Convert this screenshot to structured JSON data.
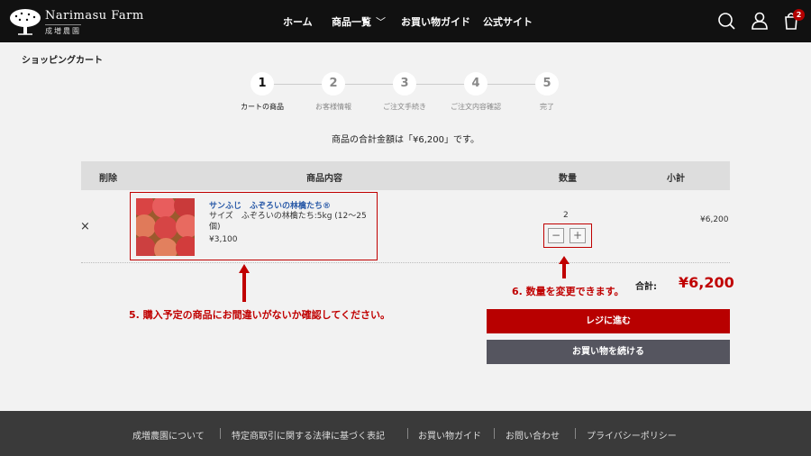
{
  "header": {
    "brand": "Narimasu Farm",
    "brand_sub": "成増農園",
    "nav": [
      "ホーム",
      "商品一覧",
      "お買い物ガイド",
      "公式サイト"
    ],
    "cart_count": "2"
  },
  "page_title": "ショッピングカート",
  "steps": [
    {
      "num": "1",
      "label": "カートの商品"
    },
    {
      "num": "2",
      "label": "お客様情報"
    },
    {
      "num": "3",
      "label": "ご注文手続き"
    },
    {
      "num": "4",
      "label": "ご注文内容確認"
    },
    {
      "num": "5",
      "label": "完了"
    }
  ],
  "total_message": "商品の合計金額は「¥6,200」です。",
  "table": {
    "headers": [
      "削除",
      "商品内容",
      "数量",
      "小計"
    ]
  },
  "item": {
    "remove": "×",
    "name": "サンふじ　ふぞろいの林檎たち®",
    "size": "サイズ　ふぞろいの林檎たち:5kg (12〜25個)",
    "price": "¥3,100",
    "quantity": "2",
    "minus": "−",
    "plus": "+",
    "subtotal": "¥6,200"
  },
  "summary": {
    "label": "合計:",
    "value": "¥6,200"
  },
  "annotations": {
    "note5": "5. 購入予定の商品にお間違いがないか確認してください。",
    "note6": "6. 数量を変更できます。"
  },
  "buttons": {
    "checkout": "レジに進む",
    "continue": "お買い物を続ける"
  },
  "footer": [
    "成増農園について",
    "特定商取引に関する法律に基づく表記",
    "お買い物ガイド",
    "お問い合わせ",
    "プライバシーポリシー"
  ],
  "colors": {
    "accent": "#c00000",
    "header_bg": "#111111",
    "footer_bg": "#3a3a3a",
    "link": "#2a5aa8"
  }
}
